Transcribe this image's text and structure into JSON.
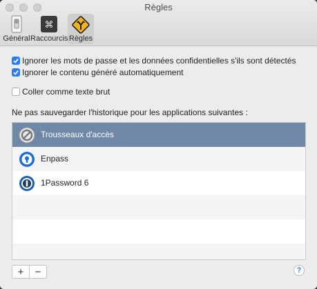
{
  "window": {
    "title": "Règles"
  },
  "toolbar": {
    "items": [
      {
        "label": "Général",
        "icon": "switch-icon"
      },
      {
        "label": "Raccourcis",
        "icon": "command-key-icon"
      },
      {
        "label": "Règles",
        "icon": "road-sign-icon",
        "selected": true
      }
    ]
  },
  "options": [
    {
      "label": "Ignorer les mots de passe et les données confidentielles s'ils sont détectés",
      "checked": true
    },
    {
      "label": "Ignorer le contenu généré automatiquement",
      "checked": true
    },
    {
      "label": "Coller comme texte brut",
      "checked": false
    }
  ],
  "apps_section": {
    "label": "Ne pas sauvegarder l'historique pour les applications suivantes :",
    "apps": [
      {
        "name": "Trousseaux d'accès",
        "icon": "keychain-icon",
        "selected": true
      },
      {
        "name": "Enpass",
        "icon": "enpass-icon",
        "selected": false
      },
      {
        "name": "1Password 6",
        "icon": "1password-icon",
        "selected": false
      }
    ]
  },
  "footer": {
    "add": "+",
    "remove": "−",
    "help": "?"
  },
  "colors": {
    "accent": "#2e7cf6",
    "selection": "#7088a8"
  }
}
